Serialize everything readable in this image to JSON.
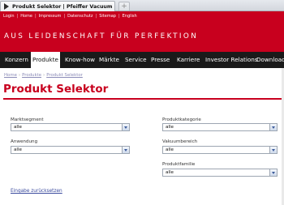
{
  "browser": {
    "tab_title": "Produkt Selektor | Pfeiffer Vacuum",
    "new_tab": "+"
  },
  "header": {
    "top_links": [
      "Login",
      "Home",
      "Impressum",
      "Datenschutz",
      "Sitemap",
      "English"
    ],
    "slogan": "AUS LEIDENSCHAFT FÜR PERFEKTION"
  },
  "nav": {
    "items": [
      "Konzern",
      "Produkte",
      "Know-how",
      "Märkte",
      "Service",
      "Presse",
      "Karriere",
      "Investor Relations",
      "Downloads"
    ],
    "active": "Produkte"
  },
  "breadcrumb": {
    "items": [
      "Home",
      "Produkte",
      "Produkt Selektor"
    ],
    "separator": "›"
  },
  "page": {
    "title": "Produkt Selektor"
  },
  "form": {
    "marktsegment": {
      "label": "Marktsegment",
      "value": "alle"
    },
    "anwendung": {
      "label": "Anwendung",
      "value": "alle"
    },
    "produktkategorie": {
      "label": "Produktkategorie",
      "value": "alle"
    },
    "vakuumbereich": {
      "label": "Vakuumbereich",
      "value": "alle"
    },
    "produktfamilie": {
      "label": "Produktfamilie",
      "value": "alle"
    },
    "reset_label": "Eingabe zurücksetzen"
  },
  "colors": {
    "brand_red": "#c8001e",
    "nav_bg": "#1a1a1a",
    "link_blue": "#3a4a9e"
  }
}
